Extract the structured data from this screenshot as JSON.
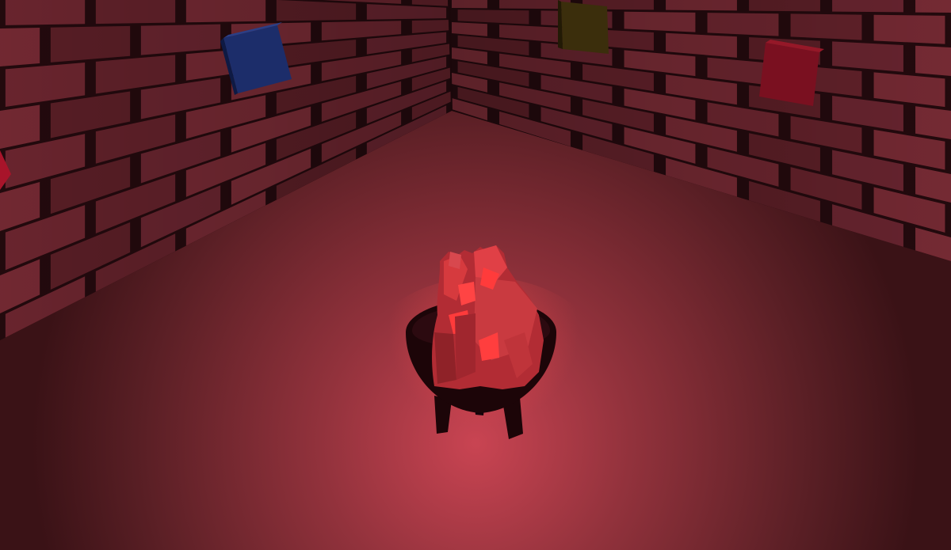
{
  "scene": {
    "type": "3d-room",
    "objects": [
      {
        "name": "cauldron",
        "state": "lit"
      },
      {
        "name": "fire",
        "state": "burning"
      },
      {
        "name": "cube-blue",
        "color": "#1c2d6a"
      },
      {
        "name": "cube-olive",
        "color": "#3b2e0c"
      },
      {
        "name": "cube-red",
        "color": "#7a1020"
      },
      {
        "name": "cube-red-left",
        "color": "#a8142a"
      }
    ]
  },
  "colors": {
    "floor": "#5a2228",
    "floor_glow": "#c5404c",
    "brick": "#6e2630",
    "mortar": "#1a070a",
    "fire": "#d63a3e",
    "fire_bright": "#ff3b3b",
    "cauldron": "#1c0508"
  }
}
